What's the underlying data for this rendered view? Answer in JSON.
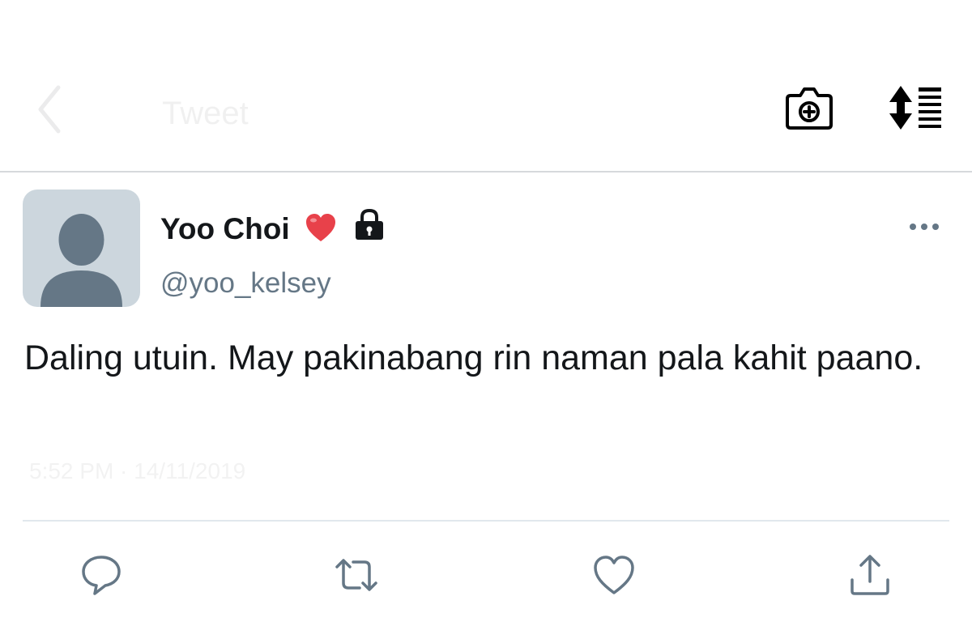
{
  "header": {
    "faded_title": "Tweet",
    "icons": {
      "back": "chevron-left-icon",
      "camera": "camera-plus-icon",
      "sort": "sort-list-icon"
    }
  },
  "tweet": {
    "author": {
      "display_name": "Yoo Choi",
      "handle": "@yoo_kelsey",
      "avatar": "default-avatar",
      "badges": [
        "heart-emoji",
        "lock-icon"
      ]
    },
    "text": "Daling utuin. May pakinabang rin naman pala kahit paano.",
    "faded_meta": "5:52 PM · 14/11/2019"
  },
  "actions": {
    "icons": [
      "reply-icon",
      "retweet-icon",
      "like-icon",
      "share-icon"
    ]
  },
  "colors": {
    "text": "#14171a",
    "secondary": "#657786",
    "avatar_bg": "#ccd6dd",
    "avatar_fg": "#657786",
    "heart": "#e8414a",
    "divider": "#e1e8ed"
  }
}
